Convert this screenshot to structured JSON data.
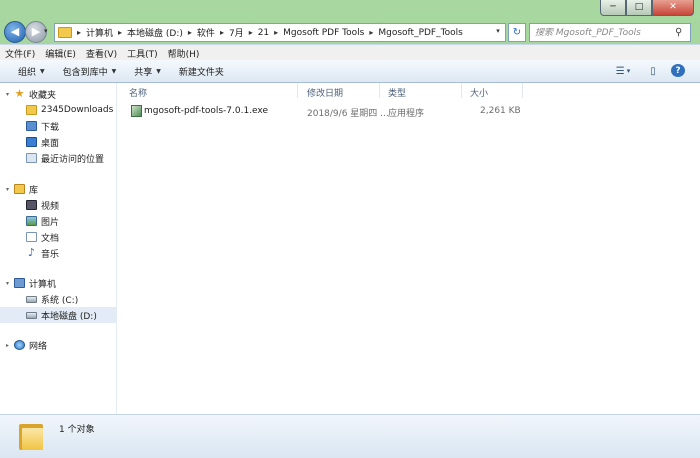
{
  "window": {
    "buttons": [
      "─",
      "□",
      "✕"
    ]
  },
  "nav": {
    "back_label": "◀",
    "forward_label": "▶",
    "dropdown_label": "▾",
    "address": {
      "crumbs": [
        "计算机",
        "本地磁盘 (D:)",
        "软件",
        "7月",
        "21",
        "Mgosoft PDF Tools",
        "Mgosoft_PDF_Tools"
      ],
      "separator": "▸",
      "dropdown_label": "▾"
    },
    "refresh_label": "↻",
    "search": {
      "placeholder": "搜索 Mgosoft_PDF_Tools",
      "icon_glyph": "⚲"
    }
  },
  "menubar": {
    "items": [
      "文件(F)",
      "编辑(E)",
      "查看(V)",
      "工具(T)",
      "帮助(H)"
    ]
  },
  "toolbar": {
    "organize": "组织",
    "include_library": "包含到库中",
    "share": "共享",
    "new_folder": "新建文件夹",
    "caret": "▼",
    "view_glyph": "☰",
    "view_caret": "▾",
    "preview_glyph": "▯",
    "help_glyph": "?"
  },
  "sidebar": {
    "favorites": {
      "label": "收藏夹",
      "items": [
        "2345Downloads",
        "下载",
        "桌面",
        "最近访问的位置"
      ]
    },
    "libraries": {
      "label": "库",
      "items": [
        "视频",
        "图片",
        "文档",
        "音乐"
      ]
    },
    "computer": {
      "label": "计算机",
      "items": [
        "系统 (C:)",
        "本地磁盘 (D:)"
      ]
    },
    "network": {
      "label": "网络"
    },
    "expander_glyph": "▸",
    "expanded_glyph": "▾",
    "star_glyph": "★",
    "music_glyph": "♪"
  },
  "columns": {
    "name": "名称",
    "modified": "修改日期",
    "type": "类型",
    "size": "大小"
  },
  "files": [
    {
      "name": "mgosoft-pdf-tools-7.0.1.exe",
      "modified": "2018/9/6 星期四 ...",
      "type": "应用程序",
      "size": "2,261 KB"
    }
  ],
  "status": {
    "text": "1 个对象"
  }
}
